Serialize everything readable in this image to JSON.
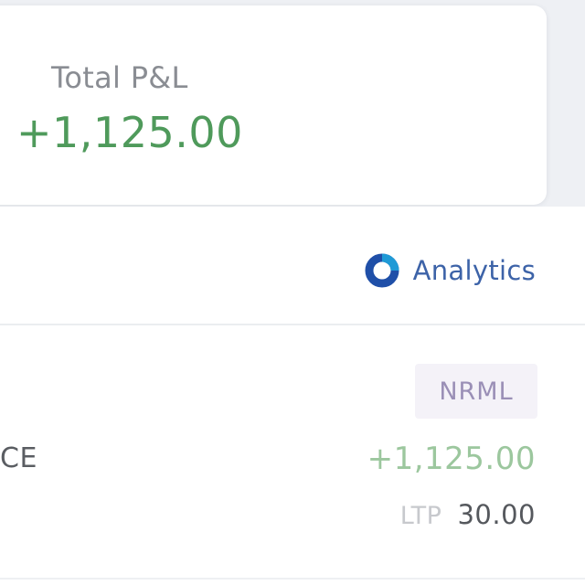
{
  "summary": {
    "total_pnl_label": "Total P&L",
    "total_pnl_value": "+1,125.00"
  },
  "analytics": {
    "label": "Analytics",
    "icon": "analytics-ring-icon",
    "color": "#1f4fa8"
  },
  "position": {
    "symbol_visible_part": "CE",
    "product": "NRML",
    "pnl": "+1,125.00",
    "ltp_label": "LTP",
    "ltp_value": "30.00"
  },
  "colors": {
    "profit": "#4f9a5b",
    "profit_muted": "#9cc79e",
    "accent": "#3d63a8",
    "badge_bg": "#f4f2f8",
    "badge_text": "#9a8fb6"
  }
}
